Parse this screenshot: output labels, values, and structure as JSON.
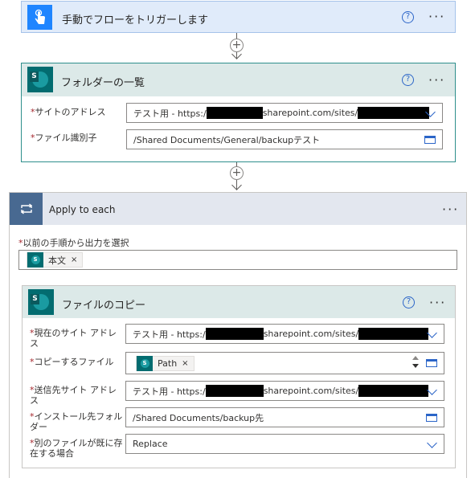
{
  "trigger": {
    "title": "手動でフローをトリガーします",
    "help": "?",
    "more": "···"
  },
  "list_folder": {
    "title": "フォルダーの一覧",
    "help": "?",
    "more": "···",
    "site_label": "サイトのアドレス",
    "site_prefix": "テスト用 - https:/",
    "site_mid": "sharepoint.com/sites/",
    "file_id_label": "ファイル識別子",
    "file_id_value": "/Shared Documents/General/backupテスト"
  },
  "apply_each": {
    "title": "Apply to each",
    "more": "···",
    "select_label": "以前の手順から出力を選択",
    "token_label": "本文",
    "token_close": "×"
  },
  "copy_file": {
    "title": "ファイルのコピー",
    "help": "?",
    "more": "···",
    "current_site_label_1": "現在のサイト アドレ",
    "current_site_label_2": "ス",
    "current_site_prefix": "テスト用 - https:/",
    "current_site_mid": "sharepoint.com/sites/",
    "file_label": "コピーするファイル",
    "file_token": "Path",
    "file_token_close": "×",
    "dest_site_label_1": "送信先サイト アドレ",
    "dest_site_label_2": "ス",
    "dest_site_prefix": "テスト用 - https:/",
    "dest_site_mid": "sharepoint.com/sites/",
    "dest_folder_label_1": "インストール先フォル",
    "dest_folder_label_2": "ダー",
    "dest_folder_value": "/Shared Documents/backup先",
    "exists_label_1": "別のファイルが既に存",
    "exists_label_2": "在する場合",
    "exists_value": "Replace"
  },
  "required_mark": "*",
  "add_step": "+",
  "colors": {
    "trigger_bg": "#e0ebfa",
    "sharepoint_header": "#dce9e8",
    "apply_header": "#e3e7ef",
    "accent": "#2b65c8",
    "required": "#a4262c"
  }
}
